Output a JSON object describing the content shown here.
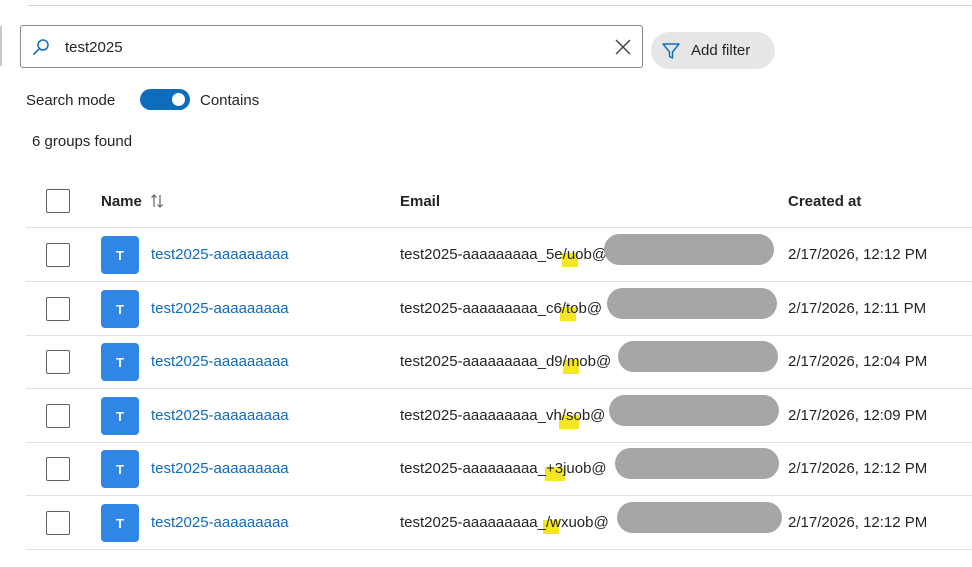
{
  "search": {
    "value": "test2025",
    "placeholder": ""
  },
  "filter": {
    "label": "Add filter"
  },
  "search_mode": {
    "label": "Search mode",
    "value": "Contains",
    "enabled": true
  },
  "result_count": "6 groups found",
  "columns": {
    "name": "Name",
    "email": "Email",
    "created": "Created at"
  },
  "rows": [
    {
      "avatar": "T",
      "name": "test2025-aaaaaaaaa",
      "email": "test2025-aaaaaaaaa_5e/uob@",
      "created": "2/17/2026, 12:12 PM"
    },
    {
      "avatar": "T",
      "name": "test2025-aaaaaaaaa",
      "email": "test2025-aaaaaaaaa_c6/tob@",
      "created": "2/17/2026, 12:11 PM"
    },
    {
      "avatar": "T",
      "name": "test2025-aaaaaaaaa",
      "email": "test2025-aaaaaaaaa_d9/mob@",
      "created": "2/17/2026, 12:04 PM"
    },
    {
      "avatar": "T",
      "name": "test2025-aaaaaaaaa",
      "email": "test2025-aaaaaaaaa_vh/sob@",
      "created": "2/17/2026, 12:09 PM"
    },
    {
      "avatar": "T",
      "name": "test2025-aaaaaaaaa",
      "email": "test2025-aaaaaaaaa_+3juob@",
      "created": "2/17/2026, 12:12 PM"
    },
    {
      "avatar": "T",
      "name": "test2025-aaaaaaaaa",
      "email": "test2025-aaaaaaaaa_/wxuob@",
      "created": "2/17/2026, 12:12 PM"
    }
  ],
  "colors": {
    "accent": "#0f6cbd",
    "avatar": "#2f86e4",
    "highlight": "#f5e625",
    "redaction": "#a6a6a8"
  }
}
